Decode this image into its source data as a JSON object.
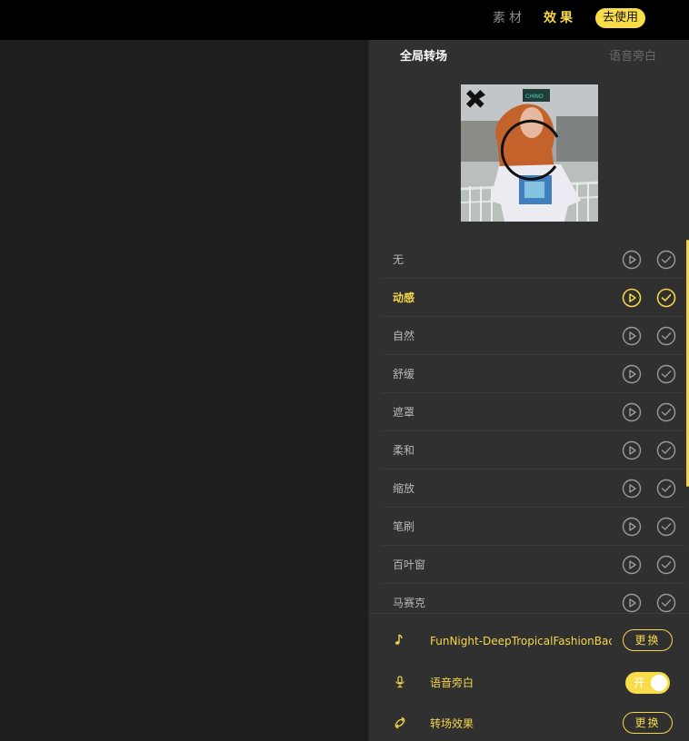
{
  "topbar": {
    "material_label": "素材",
    "effect_label": "效果",
    "use_button_label": "去使用"
  },
  "panel": {
    "tabs": [
      {
        "label": "全局转场",
        "active": true
      },
      {
        "label": "语音旁白",
        "active": false
      }
    ],
    "transitions": [
      {
        "label": "无",
        "active": false
      },
      {
        "label": "动感",
        "active": true
      },
      {
        "label": "自然",
        "active": false
      },
      {
        "label": "舒缓",
        "active": false
      },
      {
        "label": "遮罩",
        "active": false
      },
      {
        "label": "柔和",
        "active": false
      },
      {
        "label": "缩放",
        "active": false
      },
      {
        "label": "笔刷",
        "active": false
      },
      {
        "label": "百叶窗",
        "active": false
      },
      {
        "label": "马赛克",
        "active": false
      }
    ]
  },
  "bottom": {
    "music_label": "FunNight-DeepTropicalFashionBackground",
    "music_replace_label": "更换",
    "voiceover_label": "语音旁白",
    "voiceover_toggle_label": "开",
    "transition_label": "转场效果",
    "transition_replace_label": "更换"
  },
  "colors": {
    "accent": "#f5d64a",
    "panel_bg": "#303030",
    "canvas_bg": "#1e1e1e",
    "topbar_bg": "#000000"
  },
  "icons": {
    "play": "play-circle-icon",
    "check": "check-circle-icon",
    "music": "music-note-icon",
    "mic": "microphone-icon",
    "transition": "transition-arrows-icon"
  }
}
